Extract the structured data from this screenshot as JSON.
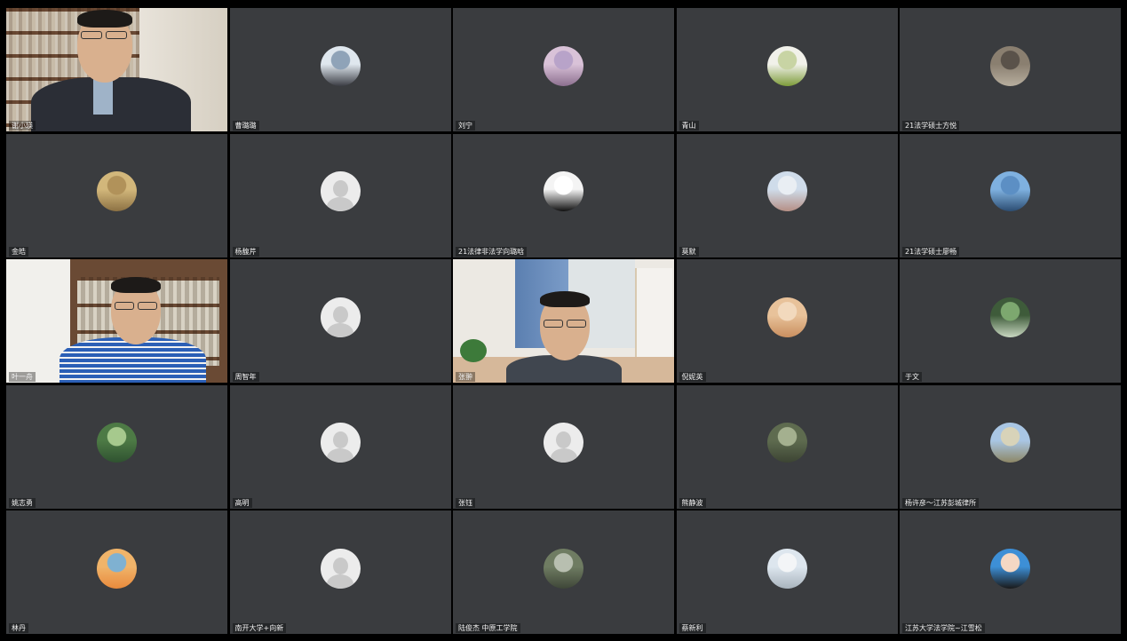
{
  "participants": [
    {
      "name": "谢小瑛",
      "type": "video",
      "active": true
    },
    {
      "name": "曹璐璐",
      "type": "photo",
      "colors": [
        "#dfe7ee",
        "#8fa3b8",
        "#3b3d44"
      ]
    },
    {
      "name": "刘宁",
      "type": "photo",
      "colors": [
        "#d9c2d8",
        "#b8a3c9",
        "#8c6f8f"
      ]
    },
    {
      "name": "青山",
      "type": "photo",
      "colors": [
        "#f1f1ea",
        "#c8d4a4",
        "#7d9c3a"
      ]
    },
    {
      "name": "21法学硕士方悦",
      "type": "photo",
      "colors": [
        "#8a7f70",
        "#5a524a",
        "#b7ae9e"
      ]
    },
    {
      "name": "金皓",
      "type": "photo",
      "colors": [
        "#d2b77b",
        "#b1925a",
        "#8c7143"
      ]
    },
    {
      "name": "杨馥芹",
      "type": "default"
    },
    {
      "name": "21法律非法学向璐晗",
      "type": "photo",
      "colors": [
        "#f4f4f4",
        "#ffffff",
        "#111111"
      ]
    },
    {
      "name": "莫默",
      "type": "photo",
      "colors": [
        "#cfdcea",
        "#e9eef3",
        "#b58f85"
      ]
    },
    {
      "name": "21法学硕士廖畅",
      "type": "photo",
      "colors": [
        "#7fb1e0",
        "#5c8fc4",
        "#2c4d72"
      ]
    },
    {
      "name": "叶一舟",
      "type": "video"
    },
    {
      "name": "周智年",
      "type": "default"
    },
    {
      "name": "张翀",
      "type": "video"
    },
    {
      "name": "倪妮英",
      "type": "photo",
      "colors": [
        "#e8c29a",
        "#f2d9bd",
        "#c98f5f"
      ]
    },
    {
      "name": "于文",
      "type": "photo",
      "colors": [
        "#3e5b3a",
        "#7da86f",
        "#c9d8c1"
      ]
    },
    {
      "name": "姚志勇",
      "type": "photo",
      "colors": [
        "#4d7a45",
        "#a6c98d",
        "#2f5230"
      ]
    },
    {
      "name": "高明",
      "type": "default"
    },
    {
      "name": "张钰",
      "type": "default"
    },
    {
      "name": "熊静波",
      "type": "photo",
      "colors": [
        "#5e6b4f",
        "#a4b08f",
        "#3c4433"
      ]
    },
    {
      "name": "杨许彦～江苏彭城律所",
      "type": "photo",
      "colors": [
        "#a9c6e4",
        "#d8d3b9",
        "#8d8766"
      ]
    },
    {
      "name": "林丹",
      "type": "photo",
      "colors": [
        "#f0b46a",
        "#7fb1d1",
        "#e88a3c"
      ]
    },
    {
      "name": "南开大学+向新",
      "type": "default"
    },
    {
      "name": "陆俊杰 中原工学院",
      "type": "photo",
      "colors": [
        "#6f7c62",
        "#b8bfb0",
        "#3e4638"
      ]
    },
    {
      "name": "蔡新利",
      "type": "photo",
      "colors": [
        "#dde6ee",
        "#f3f5f7",
        "#a9b4bd"
      ]
    },
    {
      "name": "江苏大学法学院~江雪松",
      "type": "photo",
      "colors": [
        "#3d8fd6",
        "#f4d8c4",
        "#1a1a1a"
      ]
    }
  ]
}
